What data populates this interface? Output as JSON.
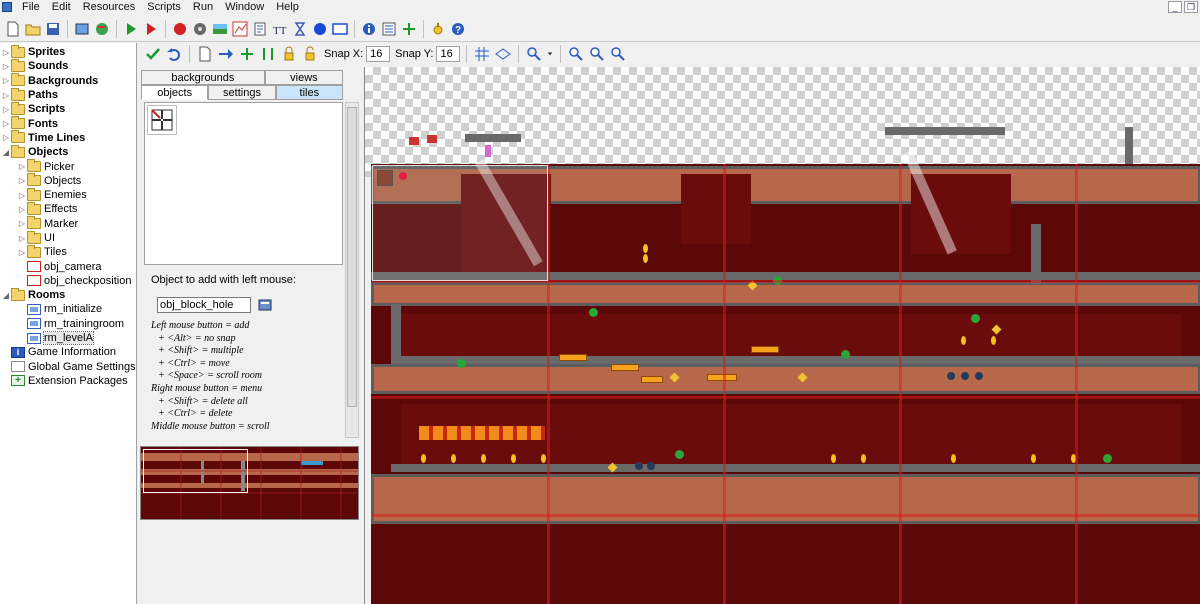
{
  "menubar": {
    "items": [
      "File",
      "Edit",
      "Resources",
      "Scripts",
      "Run",
      "Window",
      "Help"
    ]
  },
  "toolbar": {
    "icons": [
      "new-icon",
      "open-icon",
      "save-icon",
      "create-executable-icon",
      "publish-icon",
      "run-icon",
      "debug-icon",
      "create-sprite-icon",
      "create-sound-icon",
      "create-background-icon",
      "create-path-icon",
      "create-script-icon",
      "create-font-icon",
      "create-timeline-icon",
      "create-object-icon",
      "create-room-icon",
      "game-info-icon",
      "game-settings-icon",
      "extension-icon",
      "manual-icon",
      "help-icon"
    ]
  },
  "tree": {
    "items": [
      {
        "label": "Sprites",
        "level": 0,
        "type": "folder",
        "bold": true
      },
      {
        "label": "Sounds",
        "level": 0,
        "type": "folder",
        "bold": true
      },
      {
        "label": "Backgrounds",
        "level": 0,
        "type": "folder",
        "bold": true
      },
      {
        "label": "Paths",
        "level": 0,
        "type": "folder",
        "bold": true
      },
      {
        "label": "Scripts",
        "level": 0,
        "type": "folder",
        "bold": true
      },
      {
        "label": "Fonts",
        "level": 0,
        "type": "folder",
        "bold": true
      },
      {
        "label": "Time Lines",
        "level": 0,
        "type": "folder",
        "bold": true
      },
      {
        "label": "Objects",
        "level": 0,
        "type": "folder-open",
        "bold": true
      },
      {
        "label": "Picker",
        "level": 1,
        "type": "folder"
      },
      {
        "label": "Objects",
        "level": 1,
        "type": "folder"
      },
      {
        "label": "Enemies",
        "level": 1,
        "type": "folder"
      },
      {
        "label": "Effects",
        "level": 1,
        "type": "folder"
      },
      {
        "label": "Marker",
        "level": 1,
        "type": "folder"
      },
      {
        "label": "UI",
        "level": 1,
        "type": "folder"
      },
      {
        "label": "Tiles",
        "level": 1,
        "type": "folder"
      },
      {
        "label": "obj_camera",
        "level": 1,
        "type": "object"
      },
      {
        "label": "obj_checkposition",
        "level": 1,
        "type": "object"
      },
      {
        "label": "Rooms",
        "level": 0,
        "type": "folder-open",
        "bold": true
      },
      {
        "label": "rm_initialize",
        "level": 1,
        "type": "room"
      },
      {
        "label": "rm_trainingroom",
        "level": 1,
        "type": "room"
      },
      {
        "label": "rm_levelA",
        "level": 1,
        "type": "room",
        "selected": true
      },
      {
        "label": "Game Information",
        "level": 0,
        "type": "info"
      },
      {
        "label": "Global Game Settings",
        "level": 0,
        "type": "settings"
      },
      {
        "label": "Extension Packages",
        "level": 0,
        "type": "extension"
      }
    ]
  },
  "room_toolbar": {
    "snap_x_label": "Snap X:",
    "snap_x": "16",
    "snap_y_label": "Snap Y:",
    "snap_y": "16"
  },
  "tabs": {
    "row1": [
      "backgrounds",
      "views"
    ],
    "row2": [
      "objects",
      "settings",
      "tiles"
    ],
    "active": "objects"
  },
  "object_panel": {
    "add_label": "Object to add with left mouse:",
    "selected_object": "obj_block_hole",
    "help_lines": [
      {
        "text": "Left mouse button = add",
        "indent": false
      },
      {
        "text": "+ <Alt> = no snap",
        "indent": true
      },
      {
        "text": "+ <Shift> = multiple",
        "indent": true
      },
      {
        "text": "+ <Ctrl> = move",
        "indent": true
      },
      {
        "text": "+ <Space> = scroll room",
        "indent": true
      },
      {
        "text": "Right mouse button = menu",
        "indent": false
      },
      {
        "text": "+ <Shift> = delete all",
        "indent": true
      },
      {
        "text": "+ <Ctrl> = delete",
        "indent": true
      },
      {
        "text": "Middle mouse button = scroll",
        "indent": false
      }
    ]
  },
  "colors": {
    "room_background": "#5c0808",
    "terrain": "#b8684a",
    "stone": "#5d5d5d",
    "grid_lines": "#d71e1e"
  }
}
